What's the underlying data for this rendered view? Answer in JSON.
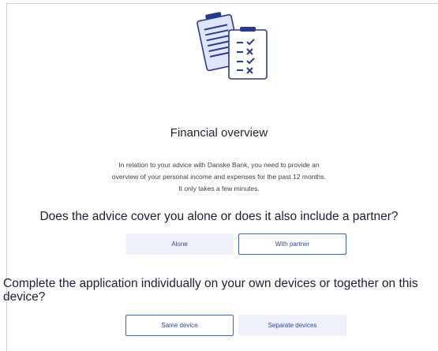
{
  "page": {
    "title": "Financial overview",
    "intro_lines": [
      "In relation to your advice with Danske Bank, you need to provide an",
      "overview of your personal income and expenses for the past 12 months.",
      "It only takes a few minutes."
    ]
  },
  "questions": [
    {
      "text": "Does the advice cover you alone or does it also include a partner?",
      "options": [
        "Alone",
        "With partner"
      ],
      "selected": "With partner"
    },
    {
      "text": "Complete the application individually on your own devices or together on this device?",
      "options": [
        "Same device",
        "Separate devices"
      ],
      "selected": "Same device"
    }
  ],
  "icons": {
    "illustration": "checklist-documents-icon"
  },
  "colors": {
    "accent": "#3a63c7",
    "option_bg": "#eef1fb",
    "option_text": "#2b4aa0",
    "illustration_dark": "#2b3a8c",
    "illustration_light": "#dfe6fb"
  }
}
